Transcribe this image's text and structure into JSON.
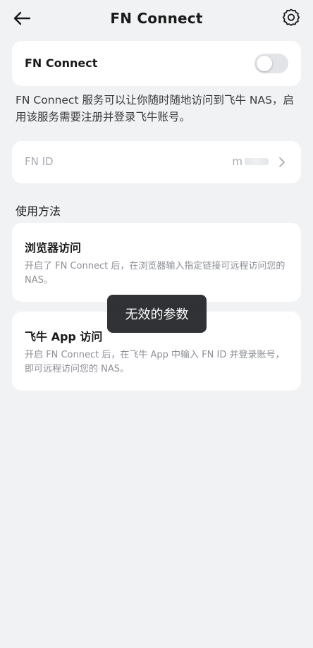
{
  "header": {
    "back_icon": "arrow-left-icon",
    "title": "FN Connect",
    "settings_icon": "gear-icon"
  },
  "toggle_card": {
    "label": "FN Connect",
    "enabled": false
  },
  "description": "FN Connect 服务可以让你随时随地访问到飞牛 NAS，启用该服务需要注册并登录飞牛账号。",
  "fn_id_card": {
    "label": "FN ID",
    "value_visible": "m",
    "chevron_icon": "chevron-right-icon"
  },
  "usage": {
    "section_title": "使用方法",
    "browser": {
      "heading": "浏览器访问",
      "body": "开启了 FN Connect 后，在浏览器输入指定链接可远程访问您的 NAS。"
    },
    "app": {
      "heading": "飞牛 App 访问",
      "body": "开启 FN Connect 后，在飞牛 App 中输入 FN ID 并登录账号，即可远程访问您的 NAS。"
    }
  },
  "toast": {
    "message": "无效的参数"
  },
  "colors": {
    "background": "#f1f2f4",
    "card": "#ffffff",
    "switch_off": "#e3e4e8",
    "muted_text": "#8c8f96",
    "toast_bg": "#202124"
  }
}
